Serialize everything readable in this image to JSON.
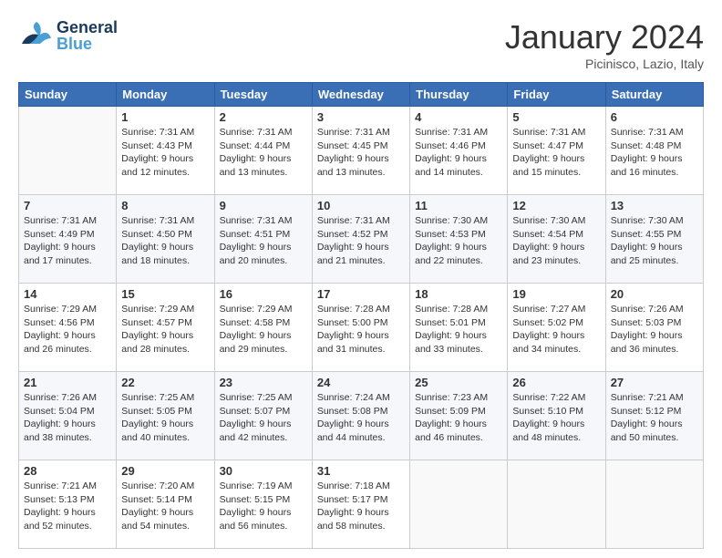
{
  "header": {
    "logo_general": "General",
    "logo_blue": "Blue",
    "month_title": "January 2024",
    "location": "Picinisco, Lazio, Italy"
  },
  "days_of_week": [
    "Sunday",
    "Monday",
    "Tuesday",
    "Wednesday",
    "Thursday",
    "Friday",
    "Saturday"
  ],
  "weeks": [
    [
      {
        "day": "",
        "sunrise": "",
        "sunset": "",
        "daylight": ""
      },
      {
        "day": "1",
        "sunrise": "Sunrise: 7:31 AM",
        "sunset": "Sunset: 4:43 PM",
        "daylight": "Daylight: 9 hours and 12 minutes."
      },
      {
        "day": "2",
        "sunrise": "Sunrise: 7:31 AM",
        "sunset": "Sunset: 4:44 PM",
        "daylight": "Daylight: 9 hours and 13 minutes."
      },
      {
        "day": "3",
        "sunrise": "Sunrise: 7:31 AM",
        "sunset": "Sunset: 4:45 PM",
        "daylight": "Daylight: 9 hours and 13 minutes."
      },
      {
        "day": "4",
        "sunrise": "Sunrise: 7:31 AM",
        "sunset": "Sunset: 4:46 PM",
        "daylight": "Daylight: 9 hours and 14 minutes."
      },
      {
        "day": "5",
        "sunrise": "Sunrise: 7:31 AM",
        "sunset": "Sunset: 4:47 PM",
        "daylight": "Daylight: 9 hours and 15 minutes."
      },
      {
        "day": "6",
        "sunrise": "Sunrise: 7:31 AM",
        "sunset": "Sunset: 4:48 PM",
        "daylight": "Daylight: 9 hours and 16 minutes."
      }
    ],
    [
      {
        "day": "7",
        "sunrise": "Sunrise: 7:31 AM",
        "sunset": "Sunset: 4:49 PM",
        "daylight": "Daylight: 9 hours and 17 minutes."
      },
      {
        "day": "8",
        "sunrise": "Sunrise: 7:31 AM",
        "sunset": "Sunset: 4:50 PM",
        "daylight": "Daylight: 9 hours and 18 minutes."
      },
      {
        "day": "9",
        "sunrise": "Sunrise: 7:31 AM",
        "sunset": "Sunset: 4:51 PM",
        "daylight": "Daylight: 9 hours and 20 minutes."
      },
      {
        "day": "10",
        "sunrise": "Sunrise: 7:31 AM",
        "sunset": "Sunset: 4:52 PM",
        "daylight": "Daylight: 9 hours and 21 minutes."
      },
      {
        "day": "11",
        "sunrise": "Sunrise: 7:30 AM",
        "sunset": "Sunset: 4:53 PM",
        "daylight": "Daylight: 9 hours and 22 minutes."
      },
      {
        "day": "12",
        "sunrise": "Sunrise: 7:30 AM",
        "sunset": "Sunset: 4:54 PM",
        "daylight": "Daylight: 9 hours and 23 minutes."
      },
      {
        "day": "13",
        "sunrise": "Sunrise: 7:30 AM",
        "sunset": "Sunset: 4:55 PM",
        "daylight": "Daylight: 9 hours and 25 minutes."
      }
    ],
    [
      {
        "day": "14",
        "sunrise": "Sunrise: 7:29 AM",
        "sunset": "Sunset: 4:56 PM",
        "daylight": "Daylight: 9 hours and 26 minutes."
      },
      {
        "day": "15",
        "sunrise": "Sunrise: 7:29 AM",
        "sunset": "Sunset: 4:57 PM",
        "daylight": "Daylight: 9 hours and 28 minutes."
      },
      {
        "day": "16",
        "sunrise": "Sunrise: 7:29 AM",
        "sunset": "Sunset: 4:58 PM",
        "daylight": "Daylight: 9 hours and 29 minutes."
      },
      {
        "day": "17",
        "sunrise": "Sunrise: 7:28 AM",
        "sunset": "Sunset: 5:00 PM",
        "daylight": "Daylight: 9 hours and 31 minutes."
      },
      {
        "day": "18",
        "sunrise": "Sunrise: 7:28 AM",
        "sunset": "Sunset: 5:01 PM",
        "daylight": "Daylight: 9 hours and 33 minutes."
      },
      {
        "day": "19",
        "sunrise": "Sunrise: 7:27 AM",
        "sunset": "Sunset: 5:02 PM",
        "daylight": "Daylight: 9 hours and 34 minutes."
      },
      {
        "day": "20",
        "sunrise": "Sunrise: 7:26 AM",
        "sunset": "Sunset: 5:03 PM",
        "daylight": "Daylight: 9 hours and 36 minutes."
      }
    ],
    [
      {
        "day": "21",
        "sunrise": "Sunrise: 7:26 AM",
        "sunset": "Sunset: 5:04 PM",
        "daylight": "Daylight: 9 hours and 38 minutes."
      },
      {
        "day": "22",
        "sunrise": "Sunrise: 7:25 AM",
        "sunset": "Sunset: 5:05 PM",
        "daylight": "Daylight: 9 hours and 40 minutes."
      },
      {
        "day": "23",
        "sunrise": "Sunrise: 7:25 AM",
        "sunset": "Sunset: 5:07 PM",
        "daylight": "Daylight: 9 hours and 42 minutes."
      },
      {
        "day": "24",
        "sunrise": "Sunrise: 7:24 AM",
        "sunset": "Sunset: 5:08 PM",
        "daylight": "Daylight: 9 hours and 44 minutes."
      },
      {
        "day": "25",
        "sunrise": "Sunrise: 7:23 AM",
        "sunset": "Sunset: 5:09 PM",
        "daylight": "Daylight: 9 hours and 46 minutes."
      },
      {
        "day": "26",
        "sunrise": "Sunrise: 7:22 AM",
        "sunset": "Sunset: 5:10 PM",
        "daylight": "Daylight: 9 hours and 48 minutes."
      },
      {
        "day": "27",
        "sunrise": "Sunrise: 7:21 AM",
        "sunset": "Sunset: 5:12 PM",
        "daylight": "Daylight: 9 hours and 50 minutes."
      }
    ],
    [
      {
        "day": "28",
        "sunrise": "Sunrise: 7:21 AM",
        "sunset": "Sunset: 5:13 PM",
        "daylight": "Daylight: 9 hours and 52 minutes."
      },
      {
        "day": "29",
        "sunrise": "Sunrise: 7:20 AM",
        "sunset": "Sunset: 5:14 PM",
        "daylight": "Daylight: 9 hours and 54 minutes."
      },
      {
        "day": "30",
        "sunrise": "Sunrise: 7:19 AM",
        "sunset": "Sunset: 5:15 PM",
        "daylight": "Daylight: 9 hours and 56 minutes."
      },
      {
        "day": "31",
        "sunrise": "Sunrise: 7:18 AM",
        "sunset": "Sunset: 5:17 PM",
        "daylight": "Daylight: 9 hours and 58 minutes."
      },
      {
        "day": "",
        "sunrise": "",
        "sunset": "",
        "daylight": ""
      },
      {
        "day": "",
        "sunrise": "",
        "sunset": "",
        "daylight": ""
      },
      {
        "day": "",
        "sunrise": "",
        "sunset": "",
        "daylight": ""
      }
    ]
  ]
}
